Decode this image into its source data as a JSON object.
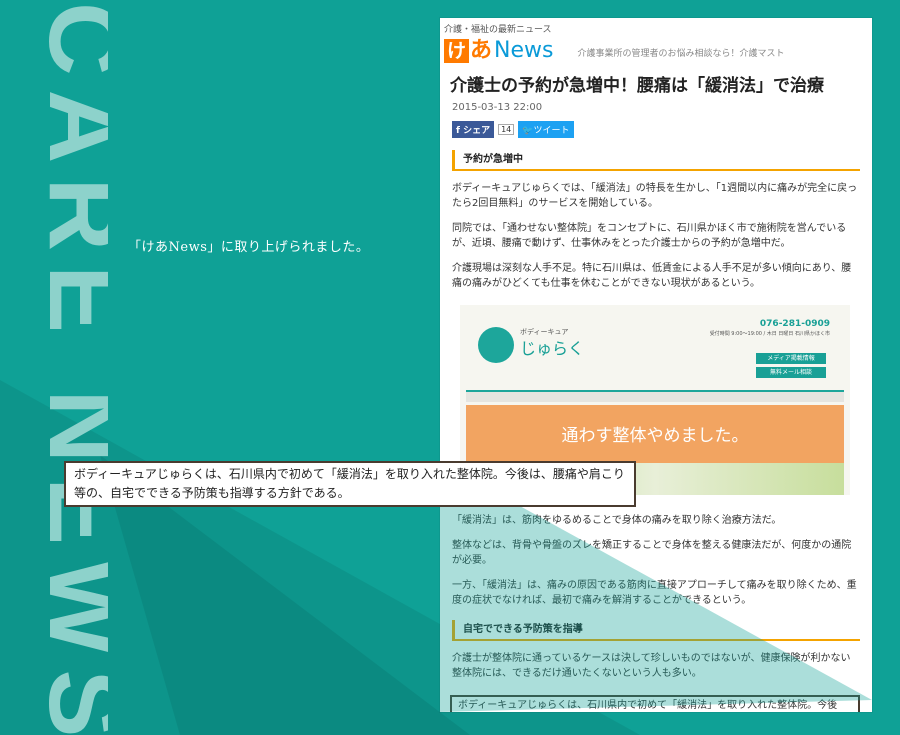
{
  "side_title": "CARE NEWS",
  "caption": "「けあNews」に取り上げられました。",
  "article": {
    "topline": "介護・福祉の最新ニュース",
    "logo": {
      "ke": "け",
      "a": "あ",
      "news": "News"
    },
    "tagline": "介護事業所の管理者のお悩み相談なら！介護マスト",
    "headline": "介護士の予約が急増中！腰痛は「緩消法」で治療",
    "date": "2015-03-13 22:00",
    "share_label": "シェア",
    "share_count": "14",
    "tweet_label": "ツイート",
    "section1": "予約が急増中",
    "para1": "ボディーキュアじゅらくでは、「緩消法」の特長を生かし、「1週間以内に痛みが完全に戻ったら2回目無料」のサービスを開始している。",
    "para2": "同院では、「通わせない整体院」をコンセプトに、石川県かほく市で施術院を営んでいるが、近頃、腰痛で動けず、仕事休みをとった介護士からの予約が急増中だ。",
    "para3": "介護現場は深刻な人手不足。特に石川県は、低賃金による人手不足が多い傾向にあり、腰痛の痛みがひどくても仕事を休むことができない現状があるという。",
    "site": {
      "name_small": "ボディーキュア",
      "name": "じゅらく",
      "tel": "076-281-0909",
      "info": "受付時間 9:00〜19:00 / 木日 日曜日 石川県かほく市",
      "btn1": "メディア掲載情報",
      "btn2": "無料メール相談",
      "banner": "通わす整体やめました。"
    },
    "para4": "「緩消法」は、筋肉をゆるめることで身体の痛みを取り除く治療方法だ。",
    "para5": "整体などは、背骨や骨盤のズレを矯正することで身体を整える健康法だが、何度かの通院が必要。",
    "para6": "一方、「緩消法」は、痛みの原因である筋肉に直接アプローチして痛みを取り除くため、重度の症状でなければ、最初で痛みを解消することができるという。",
    "section2": "自宅でできる予防策を指導",
    "para7": "介護士が整体院に通っているケースは決して珍しいものではないが、健康保険が利かない整体院には、できるだけ通いたくないという人も多い。",
    "highlight": "ボディーキュアじゅらくは、石川県内で初めて「緩消法」を取り入れた整体院。今後は、腰痛や肩こり等の、自宅でできる予防策も指導する方針である。"
  },
  "callout": "ボディーキュアじゅらくは、石川県内で初めて「緩消法」を取り入れた整体院。今後は、腰痛や肩こり等の、自宅でできる予防策も指導する方針である。",
  "colors": {
    "bg": "#0fa196",
    "accent": "#f4a300",
    "brown": "#4a3b2f"
  }
}
